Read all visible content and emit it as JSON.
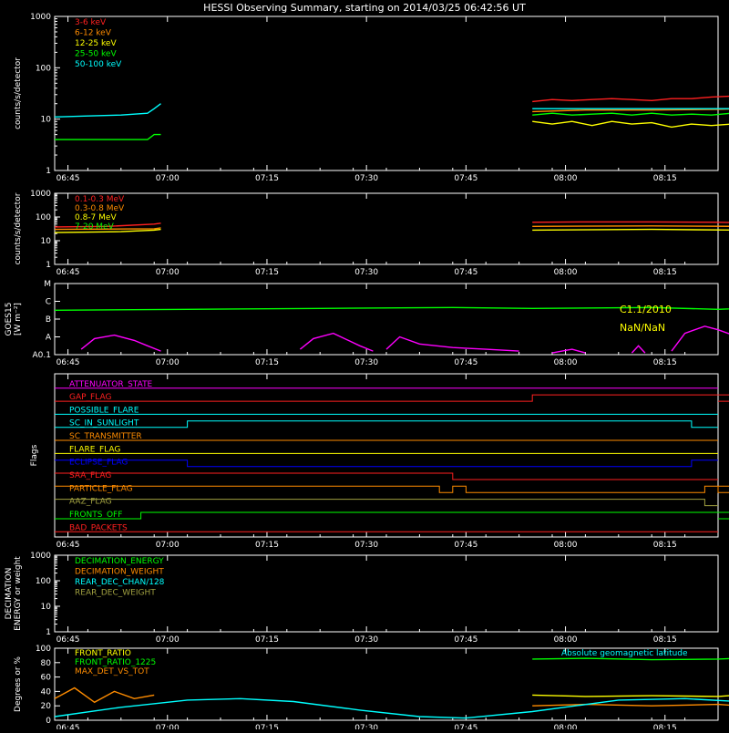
{
  "title": "HESSI Observing Summary, starting on 2014/03/25 06:42:56 UT",
  "time_ticks": [
    "06:45",
    "07:00",
    "07:15",
    "07:30",
    "07:45",
    "08:00",
    "08:15"
  ],
  "time_range_min": [
    0,
    100
  ],
  "chart_data": [
    {
      "type": "line",
      "ylabel": "counts/s/detector",
      "yscale": "log",
      "ylim": [
        1,
        1000
      ],
      "yticks": [
        "1",
        "10",
        "100",
        "1000"
      ],
      "series": [
        {
          "name": "3-6 keV",
          "color": "#ff2020",
          "segments": [
            [
              [
                72,
                22
              ],
              [
                75,
                24
              ],
              [
                78,
                23
              ],
              [
                81,
                24
              ],
              [
                84,
                25
              ],
              [
                87,
                24
              ],
              [
                90,
                23
              ],
              [
                93,
                25
              ],
              [
                96,
                25
              ],
              [
                99,
                27
              ],
              [
                102,
                28
              ],
              [
                103,
                28
              ]
            ]
          ]
        },
        {
          "name": "6-12 keV",
          "color": "#ff8c00",
          "segments": [
            [
              [
                72,
                14
              ],
              [
                80,
                15
              ],
              [
                90,
                15
              ],
              [
                100,
                15.5
              ],
              [
                103,
                16
              ]
            ]
          ]
        },
        {
          "name": "12-25 keV",
          "color": "#ffff00",
          "segments": [
            [
              [
                72,
                9
              ],
              [
                75,
                8
              ],
              [
                78,
                9
              ],
              [
                81,
                7.5
              ],
              [
                84,
                9
              ],
              [
                87,
                8
              ],
              [
                90,
                8.5
              ],
              [
                93,
                7
              ],
              [
                96,
                8
              ],
              [
                99,
                7.5
              ],
              [
                102,
                8
              ],
              [
                103,
                7.5
              ]
            ]
          ]
        },
        {
          "name": "25-50 keV",
          "color": "#00ff00",
          "segments": [
            [
              [
                0,
                4
              ],
              [
                14,
                4
              ],
              [
                15,
                5
              ],
              [
                16,
                5
              ]
            ],
            [
              [
                72,
                12
              ],
              [
                75,
                13
              ],
              [
                78,
                12
              ],
              [
                81,
                12.5
              ],
              [
                84,
                13
              ],
              [
                87,
                12
              ],
              [
                90,
                13
              ],
              [
                93,
                12
              ],
              [
                96,
                12.5
              ],
              [
                99,
                12
              ],
              [
                102,
                13
              ],
              [
                103,
                12
              ]
            ],
            [
              [
                103.5,
                4
              ],
              [
                110,
                4.5
              ],
              [
                115,
                4
              ],
              [
                120,
                4.5
              ],
              [
                125,
                4
              ],
              [
                128,
                4.5
              ]
            ]
          ]
        },
        {
          "name": "50-100 keV",
          "color": "#00ffff",
          "segments": [
            [
              [
                0,
                11
              ],
              [
                5,
                11.5
              ],
              [
                10,
                12
              ],
              [
                14,
                13
              ],
              [
                15,
                16
              ],
              [
                16,
                20
              ]
            ],
            [
              [
                72,
                16
              ],
              [
                80,
                16
              ],
              [
                90,
                16
              ],
              [
                100,
                16
              ],
              [
                103,
                16
              ]
            ],
            [
              [
                103.5,
                11
              ],
              [
                110,
                11
              ],
              [
                118,
                11
              ],
              [
                128,
                11
              ]
            ]
          ]
        }
      ]
    },
    {
      "type": "line",
      "ylabel": "counts/s/detector",
      "yscale": "log",
      "ylim": [
        1,
        1000
      ],
      "yticks": [
        "1",
        "10",
        "100",
        "1000"
      ],
      "series": [
        {
          "name": "0.1-0.3 MeV",
          "color": "#ff2020",
          "segments": [
            [
              [
                0,
                38
              ],
              [
                8,
                40
              ],
              [
                15,
                50
              ],
              [
                16,
                55
              ]
            ],
            [
              [
                72,
                60
              ],
              [
                80,
                62
              ],
              [
                90,
                62
              ],
              [
                100,
                60
              ],
              [
                103,
                58
              ],
              [
                110,
                50
              ],
              [
                128,
                40
              ]
            ]
          ]
        },
        {
          "name": "0.3-0.8 MeV",
          "color": "#ff8c00",
          "segments": [
            [
              [
                0,
                30
              ],
              [
                15,
                32
              ],
              [
                16,
                35
              ]
            ],
            [
              [
                72,
                40
              ],
              [
                90,
                42
              ],
              [
                103,
                40
              ],
              [
                110,
                32
              ],
              [
                128,
                28
              ]
            ]
          ]
        },
        {
          "name": "0.8-7 MeV",
          "color": "#ffff00",
          "segments": [
            [
              [
                0,
                22
              ],
              [
                10,
                24
              ],
              [
                15,
                28
              ],
              [
                16,
                30
              ]
            ],
            [
              [
                72,
                28
              ],
              [
                90,
                30
              ],
              [
                103,
                28
              ],
              [
                110,
                20
              ],
              [
                128,
                18
              ]
            ]
          ]
        },
        {
          "name": "7-20 MeV",
          "color": "#00ff00",
          "segments": []
        }
      ]
    },
    {
      "type": "line",
      "ylabel": "GOES15 [W m⁻²]",
      "ylevels": [
        "A0.1",
        "A",
        "B",
        "C",
        "M"
      ],
      "annotations": [
        "C1.1/2010",
        "NaN/NaN"
      ],
      "series": [
        {
          "name": "GOES long",
          "color": "#00ff00",
          "segments": [
            [
              [
                0,
                2.5
              ],
              [
                20,
                2.55
              ],
              [
                40,
                2.6
              ],
              [
                60,
                2.65
              ],
              [
                72,
                2.6
              ],
              [
                90,
                2.65
              ],
              [
                100,
                2.55
              ],
              [
                110,
                2.7
              ],
              [
                115,
                2.65
              ],
              [
                128,
                2.6
              ]
            ]
          ]
        },
        {
          "name": "GOES short",
          "color": "#ff00ff",
          "segments": [
            [
              [
                4,
                0.3
              ],
              [
                6,
                0.9
              ],
              [
                9,
                1.1
              ],
              [
                12,
                0.8
              ],
              [
                14,
                0.5
              ],
              [
                16,
                0.2
              ]
            ],
            [
              [
                37,
                0.3
              ],
              [
                39,
                0.9
              ],
              [
                42,
                1.2
              ],
              [
                46,
                0.5
              ],
              [
                48,
                0.2
              ]
            ],
            [
              [
                50,
                0.3
              ],
              [
                52,
                1.0
              ],
              [
                55,
                0.6
              ],
              [
                60,
                0.4
              ],
              [
                65,
                0.3
              ],
              [
                70,
                0.2
              ]
            ],
            [
              [
                75,
                0.1
              ],
              [
                78,
                0.3
              ],
              [
                80,
                0.1
              ]
            ],
            [
              [
                87,
                0.1
              ],
              [
                88,
                0.5
              ],
              [
                89,
                0.1
              ]
            ],
            [
              [
                93,
                0.2
              ],
              [
                95,
                1.2
              ],
              [
                98,
                1.6
              ],
              [
                100,
                1.4
              ],
              [
                103,
                1.0
              ],
              [
                106,
                1.2
              ],
              [
                110,
                0.7
              ],
              [
                115,
                0.9
              ],
              [
                120,
                0.5
              ],
              [
                125,
                0.3
              ],
              [
                128,
                0.2
              ]
            ]
          ]
        }
      ]
    },
    {
      "type": "table",
      "ylabel": "Flags",
      "flags": [
        {
          "name": "ATTENUATOR_STATE",
          "color": "#ff00ff"
        },
        {
          "name": "GAP_FLAG",
          "color": "#ff2020"
        },
        {
          "name": "POSSIBLE_FLARE",
          "color": "#00ffff"
        },
        {
          "name": "SC_IN_SUNLIGHT",
          "color": "#00ffff"
        },
        {
          "name": "SC_TRANSMITTER",
          "color": "#ff8c00"
        },
        {
          "name": "FLARE_FLAG",
          "color": "#ffff00"
        },
        {
          "name": "ECLIPSE_FLAG",
          "color": "#0000ff"
        },
        {
          "name": "SAA_FLAG",
          "color": "#ff2020"
        },
        {
          "name": "PARTICLE_FLAG",
          "color": "#ff8c00"
        },
        {
          "name": "AAZ_FLAG",
          "color": "#a0a040"
        },
        {
          "name": "FRONTS_OFF",
          "color": "#00ff00"
        },
        {
          "name": "BAD_PACKETS",
          "color": "#ff2020"
        }
      ]
    },
    {
      "type": "line",
      "ylabel": "DECIMATION ENERGY or weight",
      "yscale": "log",
      "ylim": [
        1,
        1000
      ],
      "yticks": [
        "1",
        "10",
        "100",
        "1000"
      ],
      "series": [
        {
          "name": "DECIMATION_ENERGY",
          "color": "#00ff00",
          "segments": []
        },
        {
          "name": "DECIMATION_WEIGHT",
          "color": "#ff8c00",
          "segments": []
        },
        {
          "name": "REAR_DEC_CHAN/128",
          "color": "#00ffff",
          "segments": []
        },
        {
          "name": "REAR_DEC_WEIGHT",
          "color": "#a0a040",
          "segments": []
        }
      ]
    },
    {
      "type": "line",
      "ylabel": "Degrees or %",
      "ylim": [
        0,
        100
      ],
      "yticks": [
        "0",
        "20",
        "40",
        "60",
        "80",
        "100"
      ],
      "annotations": [
        "Absolute geomagnetic latitude"
      ],
      "series": [
        {
          "name": "FRONT_RATIO",
          "color": "#ffff00",
          "segments": [
            [
              [
                72,
                35
              ],
              [
                80,
                33
              ],
              [
                90,
                34
              ],
              [
                100,
                33
              ],
              [
                103,
                35
              ]
            ]
          ]
        },
        {
          "name": "FRONT_RATIO_1225",
          "color": "#00ff00",
          "segments": [
            [
              [
                72,
                85
              ],
              [
                80,
                86
              ],
              [
                90,
                84
              ],
              [
                100,
                85
              ],
              [
                103,
                86
              ]
            ]
          ]
        },
        {
          "name": "MAX_DET_VS_TOT",
          "color": "#ff8c00",
          "segments": [
            [
              [
                0,
                30
              ],
              [
                3,
                45
              ],
              [
                6,
                25
              ],
              [
                9,
                40
              ],
              [
                12,
                30
              ],
              [
                15,
                35
              ]
            ],
            [
              [
                72,
                20
              ],
              [
                80,
                22
              ],
              [
                90,
                20
              ],
              [
                100,
                22
              ],
              [
                103,
                20
              ],
              [
                106,
                35
              ],
              [
                110,
                45
              ],
              [
                115,
                30
              ],
              [
                120,
                50
              ],
              [
                125,
                35
              ],
              [
                128,
                40
              ]
            ]
          ]
        },
        {
          "name": "Absolute geomagnetic latitude",
          "color": "#00ffff",
          "segments": [
            [
              [
                0,
                5
              ],
              [
                10,
                18
              ],
              [
                20,
                28
              ],
              [
                28,
                30
              ],
              [
                36,
                26
              ],
              [
                46,
                14
              ],
              [
                55,
                5
              ],
              [
                62,
                3
              ],
              [
                72,
                12
              ],
              [
                85,
                28
              ],
              [
                95,
                30
              ],
              [
                103,
                26
              ],
              [
                110,
                14
              ],
              [
                115,
                5
              ],
              [
                120,
                3
              ],
              [
                128,
                12
              ]
            ]
          ]
        }
      ]
    }
  ]
}
